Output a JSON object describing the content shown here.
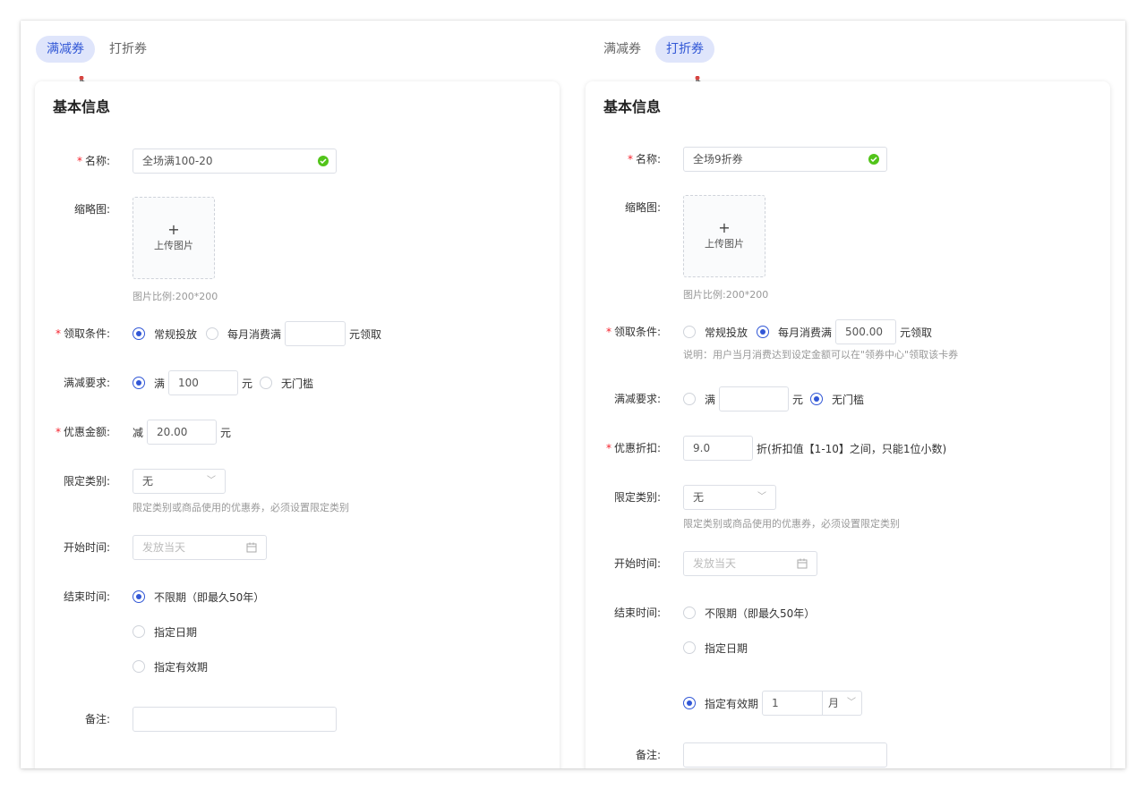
{
  "left": {
    "tabs": [
      {
        "label": "满减券",
        "active": true
      },
      {
        "label": "打折券",
        "active": false
      }
    ],
    "section_title": "基本信息",
    "name": {
      "label": "名称:",
      "value": "全场满100-20"
    },
    "thumbnail": {
      "label": "缩略图:",
      "upload_text": "上传图片",
      "hint": "图片比例:200*200"
    },
    "condition": {
      "label": "领取条件:",
      "opt1": "常规投放",
      "opt2": "每月消费满",
      "amount": "",
      "suffix": "元领取",
      "selected": 1
    },
    "requirement": {
      "label": "满减要求:",
      "opt1": "满",
      "amount": "100",
      "unit": "元",
      "opt2": "无门槛",
      "selected": 1
    },
    "discount": {
      "label": "优惠金额:",
      "prefix": "减",
      "value": "20.00",
      "unit": "元"
    },
    "category": {
      "label": "限定类别:",
      "value": "无",
      "hint": "限定类别或商品使用的优惠券，必须设置限定类别"
    },
    "start": {
      "label": "开始时间:",
      "placeholder": "发放当天"
    },
    "end": {
      "label": "结束时间:",
      "opt1": "不限期（即最久50年）",
      "opt2": "指定日期",
      "opt3": "指定有效期",
      "selected": 1
    },
    "remark": {
      "label": "备注:",
      "value": ""
    }
  },
  "right": {
    "tabs": [
      {
        "label": "满减券",
        "active": false
      },
      {
        "label": "打折券",
        "active": true
      }
    ],
    "section_title": "基本信息",
    "name": {
      "label": "名称:",
      "value": "全场9折券"
    },
    "thumbnail": {
      "label": "缩略图:",
      "upload_text": "上传图片",
      "hint": "图片比例:200*200"
    },
    "condition": {
      "label": "领取条件:",
      "opt1": "常规投放",
      "opt2": "每月消费满",
      "amount": "500.00",
      "suffix": "元领取",
      "selected": 2,
      "note": "说明：用户当月消费达到设定金额可以在\"领券中心\"领取该卡券"
    },
    "requirement": {
      "label": "满减要求:",
      "opt1": "满",
      "amount": "",
      "unit": "元",
      "opt2": "无门槛",
      "selected": 2
    },
    "discount": {
      "label": "优惠折扣:",
      "value": "9.0",
      "suffix": "折(折扣值【1-10】之间，只能1位小数)"
    },
    "category": {
      "label": "限定类别:",
      "value": "无",
      "hint": "限定类别或商品使用的优惠券，必须设置限定类别"
    },
    "start": {
      "label": "开始时间:",
      "placeholder": "发放当天"
    },
    "end": {
      "label": "结束时间:",
      "opt1": "不限期（即最久50年）",
      "opt2": "指定日期",
      "opt3": "指定有效期",
      "period_value": "1",
      "period_unit": "月",
      "selected": 3
    },
    "remark": {
      "label": "备注:",
      "value": ""
    }
  },
  "colors": {
    "accent": "#3157d6",
    "tab_active_bg": "#dfe5fb",
    "required": "#f5222d",
    "success": "#52c41a"
  }
}
